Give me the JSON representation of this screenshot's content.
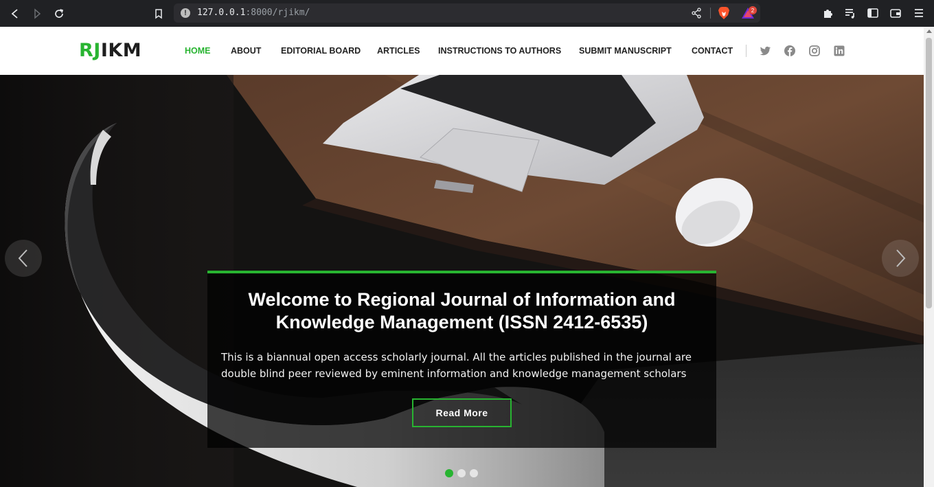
{
  "browser": {
    "url_host": "127.0.0.1",
    "url_port_path": ":8000/rjikm/",
    "rewards_badge": "2",
    "icons": [
      "back-icon",
      "forward-icon",
      "reload-icon",
      "bookmark-icon",
      "info-icon",
      "share-icon",
      "brave-shields-icon",
      "brave-rewards-icon",
      "extensions-icon",
      "playlist-icon",
      "sidebar-icon",
      "wallet-icon",
      "menu-icon"
    ]
  },
  "site": {
    "logo_accent": "RJ",
    "logo_rest": "IKM",
    "brand_color": "#28b431",
    "nav": [
      {
        "label": "HOME",
        "active": true
      },
      {
        "label": "ABOUT",
        "active": false
      },
      {
        "label": "EDITORIAL BOARD",
        "active": false
      },
      {
        "label": "ARTICLES",
        "active": false
      },
      {
        "label": "INSTRUCTIONS TO AUTHORS",
        "active": false
      },
      {
        "label": "SUBMIT MANUSCRIPT",
        "active": false
      },
      {
        "label": "CONTACT",
        "active": false
      }
    ],
    "social": [
      "twitter-icon",
      "facebook-icon",
      "instagram-icon",
      "linkedin-icon"
    ]
  },
  "hero": {
    "title": "Welcome to Regional Journal of Information and Knowledge Management (ISSN 2412-6535)",
    "description": "This is a biannual open access scholarly journal. All the articles published in the journal are double blind peer reviewed by eminent information and knowledge management scholars",
    "button_label": "Read More",
    "slides_count": 3,
    "active_slide": 1
  }
}
